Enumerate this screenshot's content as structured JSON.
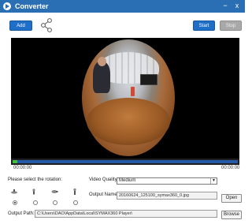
{
  "window": {
    "title": "Converter",
    "minimize_label": "−",
    "close_label": "x"
  },
  "toolbar": {
    "add_label": "Add",
    "start_label": "Start",
    "stop_label": "Stop"
  },
  "player": {
    "current_time": "00:00:00",
    "total_time": "00:00:00",
    "progress_fraction": 0.02
  },
  "rotation": {
    "label": "Please select the rotation:",
    "options": [
      {
        "icon": "rotation-flat-icon",
        "selected": true
      },
      {
        "icon": "rotation-tilt-left-icon",
        "selected": false
      },
      {
        "icon": "rotation-side-icon",
        "selected": false
      },
      {
        "icon": "rotation-upright-icon",
        "selected": false
      }
    ]
  },
  "quality": {
    "label": "Video Quality:",
    "value": "Medium"
  },
  "output_name": {
    "label": "Output Name:",
    "value": "20160624_125100_symax360_0.jpg",
    "open_label": "Open"
  },
  "output_path": {
    "label": "Output Path:",
    "value": "C:\\Users\\DAO\\AppData\\Local\\SYMAX360 Player\\",
    "browse_label": "Browse"
  },
  "colors": {
    "titlebar": "#2a6fb3",
    "accent_button": "#1f6fc8",
    "disabled_button": "#a9a9a9",
    "progress": "#3fbf3f"
  }
}
